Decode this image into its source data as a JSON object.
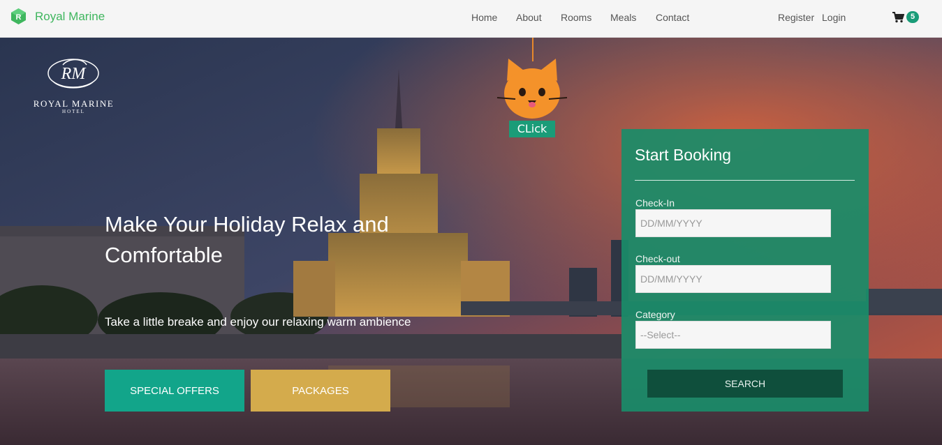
{
  "navbar": {
    "brand": "Royal Marine",
    "links": [
      "Home",
      "About",
      "Rooms",
      "Meals",
      "Contact"
    ],
    "register": "Register",
    "login": "Login",
    "cart_count": "5",
    "cart_icon": "cart-icon"
  },
  "hero": {
    "logo_name": "ROYAL MARINE",
    "logo_sub": "HOTEL",
    "title": "Make Your Holiday Relax and Comfortable",
    "subtitle": "Take a little breake and enjoy our relaxing warm ambience",
    "btn_offers": "SPECIAL OFFERS",
    "btn_packages": "PACKAGES"
  },
  "cat_widget": {
    "label": "CLick",
    "icon": "cat-icon"
  },
  "booking": {
    "title": "Start Booking",
    "checkin_label": "Check-In",
    "checkin_placeholder": "DD/MM/YYYY",
    "checkout_label": "Check-out",
    "checkout_placeholder": "DD/MM/YYYY",
    "category_label": "Category",
    "category_selected": "--Select--",
    "search_label": "SEARCH"
  },
  "colors": {
    "brand_green": "#3fb65e",
    "teal": "#12a58a",
    "gold": "#d4ab4c",
    "panel": "#1a8c69",
    "search_btn": "#0f4f3c"
  }
}
